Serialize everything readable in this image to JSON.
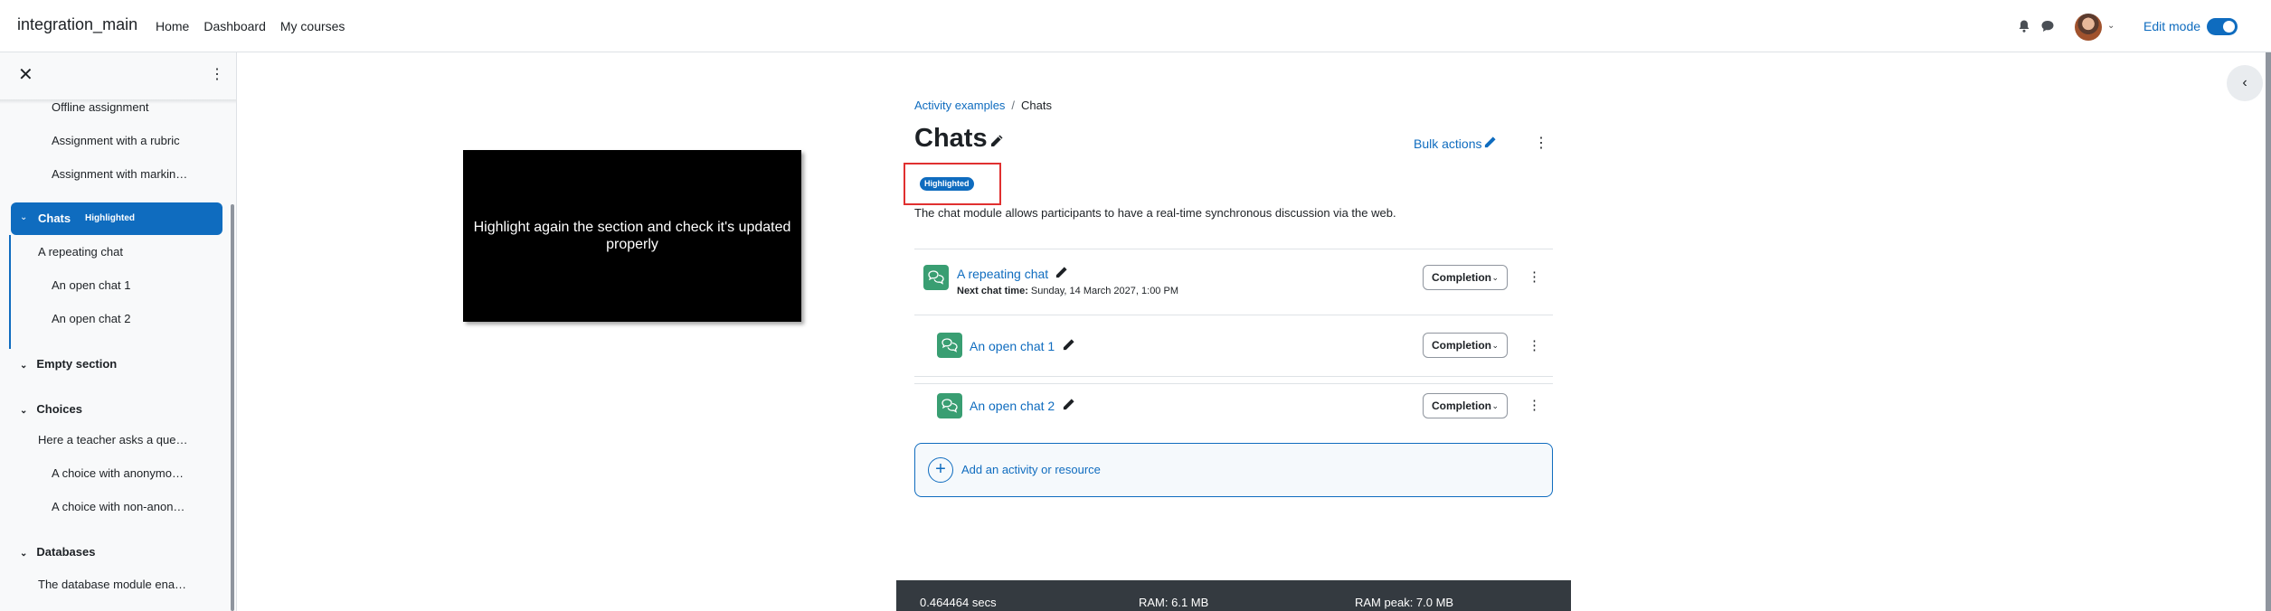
{
  "navbar": {
    "brand": "integration_main",
    "links": [
      "Home",
      "Dashboard",
      "My courses"
    ],
    "edit_mode_label": "Edit mode",
    "edit_mode_on": true
  },
  "drawer": {
    "items": [
      {
        "label": "Offline assignment"
      },
      {
        "label": "Assignment with a rubric"
      },
      {
        "label": "Assignment with markin…"
      }
    ],
    "active_section": {
      "label": "Chats",
      "badge": "Highlighted"
    },
    "chats_items": [
      "A repeating chat",
      "An open chat 1",
      "An open chat 2"
    ],
    "empty_section": "Empty section",
    "choices_section": "Choices",
    "choices_items": [
      "Here a teacher asks a que…",
      "A choice with anonymo…",
      "A choice with non-anon…"
    ],
    "databases_section": "Databases",
    "databases_items": [
      "The database module ena…"
    ]
  },
  "overlay": {
    "text": "Highlight again the section and check it's updated properly"
  },
  "main": {
    "breadcrumb": [
      "Activity examples",
      "Chats"
    ],
    "title": "Chats",
    "bulk_actions": "Bulk actions",
    "badge": "Highlighted",
    "summary": "The chat module allows participants to have a real-time synchronous discussion via the web.",
    "activities": [
      {
        "name": "A repeating chat",
        "meta_label": "Next chat time:",
        "meta_value": "Sunday, 14 March 2027, 1:00 PM",
        "completion": "Completion"
      },
      {
        "name": "An open chat 1",
        "completion": "Completion"
      },
      {
        "name": "An open chat 2",
        "completion": "Completion"
      }
    ],
    "add_activity": "Add an activity or resource"
  },
  "footer": {
    "time": "0.464464 secs",
    "ram": "RAM: 6.1 MB",
    "ram_peak": "RAM peak: 7.0 MB"
  },
  "colors": {
    "accent": "#0f6cbf",
    "activity_icon": "#399e72",
    "highlight_frame": "#e03030",
    "footer_bg": "#343a40"
  }
}
